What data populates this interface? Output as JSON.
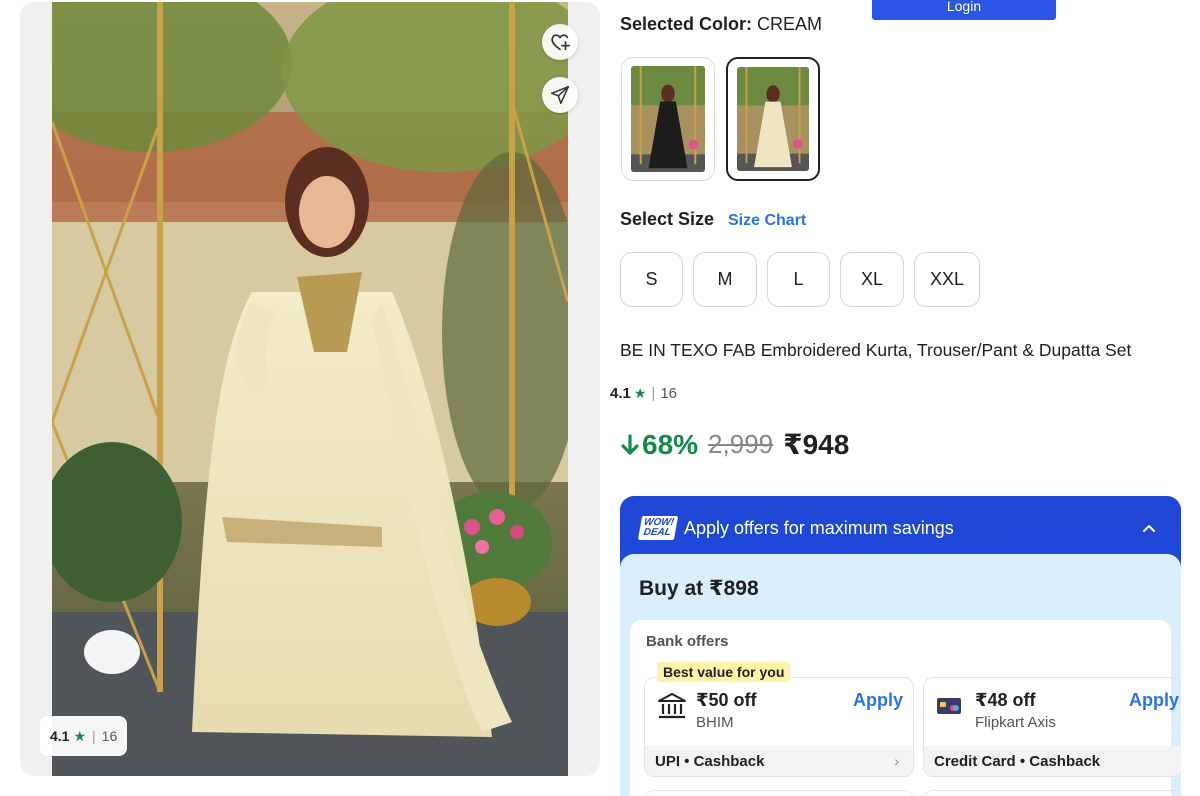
{
  "header": {
    "login_label": "Login"
  },
  "gallery": {
    "rating": "4.1",
    "star": "★",
    "divider": "|",
    "rating_count": "16",
    "icons": [
      "heart-plus-icon",
      "share-icon"
    ]
  },
  "color": {
    "label": "Selected Color:",
    "value": "CREAM",
    "swatches": [
      "black-variant",
      "cream-variant"
    ],
    "selected_index": 1
  },
  "size": {
    "label": "Select Size",
    "chart_link": "Size Chart",
    "options": [
      "S",
      "M",
      "L",
      "XL",
      "XXL"
    ]
  },
  "product": {
    "title": "BE IN TEXO FAB Embroidered Kurta, Trouser/Pant & Dupatta Set",
    "rating": "4.1",
    "star": "★",
    "divider": "|",
    "rating_count": "16"
  },
  "price": {
    "discount": "68%",
    "mrp": "2,999",
    "selling": "₹948"
  },
  "offers": {
    "deal_badge_line1": "WOW!",
    "deal_badge_line2": "DEAL",
    "header": "Apply offers for maximum savings",
    "buy_at": "Buy at ₹898",
    "bank_offers_title": "Bank offers",
    "best_badge": "Best value for you",
    "items": [
      {
        "amount": "₹50 off",
        "bank": "BHIM",
        "apply": "Apply",
        "footer": "UPI • Cashback",
        "arrow": "›"
      },
      {
        "amount": "₹48 off",
        "bank": "Flipkart Axis",
        "apply": "Apply",
        "footer": "Credit Card • Cashback"
      }
    ]
  },
  "colors": {
    "brand_blue": "#2874f0",
    "offer_blue": "#1f47d6",
    "discount_green": "#148a46",
    "offer_bg": "#d9eeff"
  }
}
